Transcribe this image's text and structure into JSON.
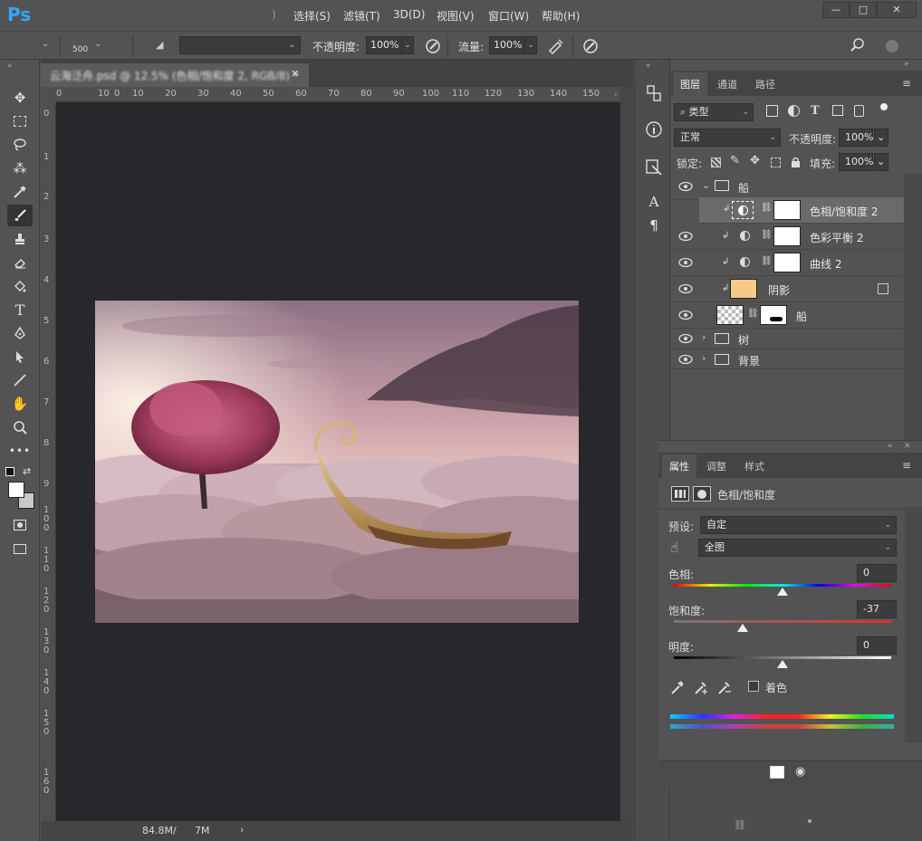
{
  "menubar": {
    "logo": "Ps",
    "items": [
      "选择(S)",
      "滤镜(T)",
      "3D(D)",
      "视图(V)",
      "窗口(W)",
      "帮助(H)"
    ],
    "window_buttons": [
      "—",
      "□",
      "✕"
    ]
  },
  "options": {
    "brush_size": "500",
    "opacity_label": "不透明度:",
    "opacity_value": "100%",
    "flow_label": "流量:",
    "flow_value": "100%"
  },
  "document": {
    "tab_title": "云海泛舟.psd @ 12.5% (色相/饱和度 2, RGB/8) *",
    "close": "✕",
    "ruler_h": [
      "0",
      "10",
      "0",
      "10",
      "20",
      "30",
      "40",
      "50",
      "60",
      "70",
      "80",
      "90",
      "100",
      "110",
      "120",
      "130",
      "140",
      "150"
    ],
    "ruler_v": [
      "0",
      "1",
      "2",
      "3",
      "4",
      "5",
      "6",
      "7",
      "8",
      "9",
      "100",
      "110",
      "120",
      "130",
      "140",
      "150",
      "160"
    ],
    "status_size": "84.8M/",
    "status_size2": "7M",
    "status_arrow": "›"
  },
  "layers_panel": {
    "tabs": [
      "图层",
      "通道",
      "路径"
    ],
    "filter_label": "类型",
    "blend_mode": "正常",
    "opacity_label": "不透明度:",
    "opacity_value": "100%",
    "lock_label": "锁定:",
    "fill_label": "填充:",
    "fill_value": "100%",
    "layers": [
      {
        "name": "船",
        "kind": "group-open"
      },
      {
        "name": "色相/饱和度 2",
        "kind": "adjustment",
        "selected": true
      },
      {
        "name": "色彩平衡 2",
        "kind": "adjustment"
      },
      {
        "name": "曲线 2",
        "kind": "adjustment"
      },
      {
        "name": "阴影",
        "kind": "fill"
      },
      {
        "name": "船",
        "kind": "smart"
      },
      {
        "name": "树",
        "kind": "group"
      },
      {
        "name": "背景",
        "kind": "group"
      }
    ]
  },
  "properties_panel": {
    "tabs": [
      "属性",
      "调整",
      "样式"
    ],
    "title": "色相/饱和度",
    "preset_label": "预设:",
    "preset_value": "自定",
    "channel_value": "全图",
    "hue_label": "色相:",
    "hue_value": "0",
    "saturation_label": "饱和度:",
    "saturation_value": "-37",
    "lightness_label": "明度:",
    "lightness_value": "0",
    "colorize_label": "着色",
    "slider_fraction": {
      "hue": 0.5,
      "saturation": 0.315,
      "lightness": 0.5
    }
  },
  "colors": {
    "logo": "#31a8ff",
    "canvas_bg": "#28272b",
    "panel_bg": "#535353",
    "shadow_fill": "#f4c98a"
  }
}
